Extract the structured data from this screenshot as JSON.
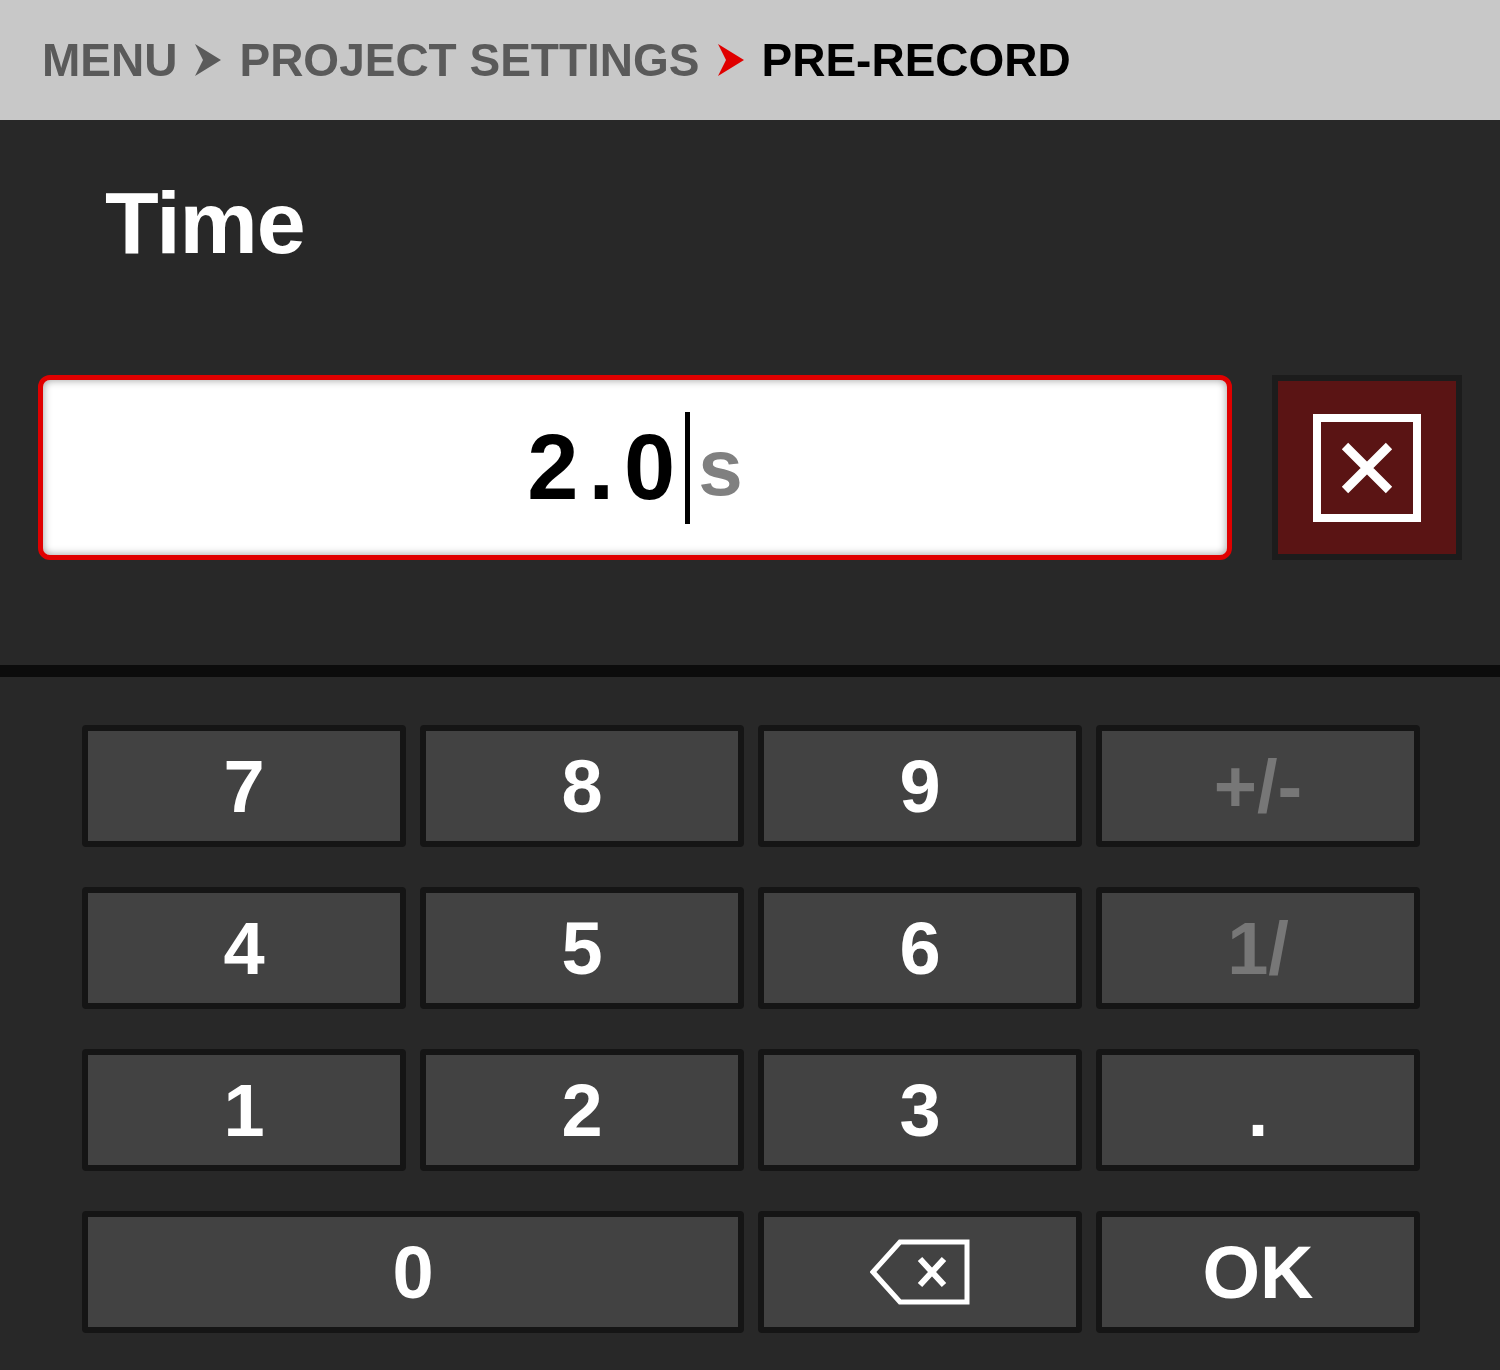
{
  "breadcrumb": [
    {
      "label": "MENU",
      "current": false
    },
    {
      "label": "PROJECT SETTINGS",
      "current": false
    },
    {
      "label": "PRE-RECORD",
      "current": true
    }
  ],
  "title": "Time",
  "field": {
    "value": "2.0",
    "unit": "s"
  },
  "keys": [
    {
      "kind": "text",
      "label": "7",
      "disabled": false
    },
    {
      "kind": "text",
      "label": "8",
      "disabled": false
    },
    {
      "kind": "text",
      "label": "9",
      "disabled": false
    },
    {
      "kind": "text",
      "label": "+/-",
      "disabled": true
    },
    {
      "kind": "text",
      "label": "4",
      "disabled": false
    },
    {
      "kind": "text",
      "label": "5",
      "disabled": false
    },
    {
      "kind": "text",
      "label": "6",
      "disabled": false
    },
    {
      "kind": "text",
      "label": "1/",
      "disabled": true
    },
    {
      "kind": "text",
      "label": "1",
      "disabled": false
    },
    {
      "kind": "text",
      "label": "2",
      "disabled": false
    },
    {
      "kind": "text",
      "label": "3",
      "disabled": false
    },
    {
      "kind": "text",
      "label": ".",
      "disabled": false
    },
    {
      "kind": "wide",
      "label": "0",
      "disabled": false
    },
    {
      "kind": "backspace",
      "disabled": false
    },
    {
      "kind": "text",
      "label": "OK",
      "disabled": false
    }
  ]
}
